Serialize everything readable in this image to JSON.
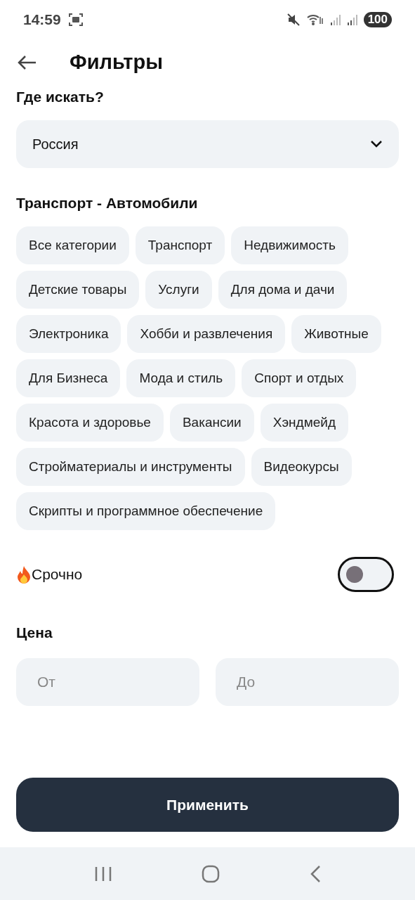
{
  "status_bar": {
    "time": "14:59",
    "battery": "100"
  },
  "header": {
    "title": "Фильтры"
  },
  "location": {
    "label": "Где искать?",
    "value": "Россия"
  },
  "category": {
    "label": "Транспорт - Автомобили",
    "chips": [
      {
        "label": "Все категории",
        "selected": false
      },
      {
        "label": "Транспорт",
        "selected": false
      },
      {
        "label": "Недвижимость",
        "selected": false
      },
      {
        "label": "Детские товары",
        "selected": false
      },
      {
        "label": "Услуги",
        "selected": false
      },
      {
        "label": "Для дома и дачи",
        "selected": false
      },
      {
        "label": "Электроника",
        "selected": false
      },
      {
        "label": "Хобби и развлечения",
        "selected": false
      },
      {
        "label": "Животные",
        "selected": false
      },
      {
        "label": "Для Бизнеса",
        "selected": false
      },
      {
        "label": "Мода и стиль",
        "selected": false
      },
      {
        "label": "Спорт и отдых",
        "selected": false
      },
      {
        "label": "Красота и здоровье",
        "selected": false
      },
      {
        "label": "Вакансии",
        "selected": false
      },
      {
        "label": "Хэндмейд",
        "selected": false
      },
      {
        "label": "Стройматериалы и инструменты",
        "selected": false
      },
      {
        "label": "Видеокурсы",
        "selected": false
      },
      {
        "label": "Скрипты и программное обеспечение",
        "selected": false
      }
    ]
  },
  "urgent": {
    "label": "Срочно",
    "on": false
  },
  "price": {
    "label": "Цена",
    "from": {
      "placeholder": "От"
    },
    "to": {
      "placeholder": "До"
    }
  },
  "apply_button": "Применить"
}
